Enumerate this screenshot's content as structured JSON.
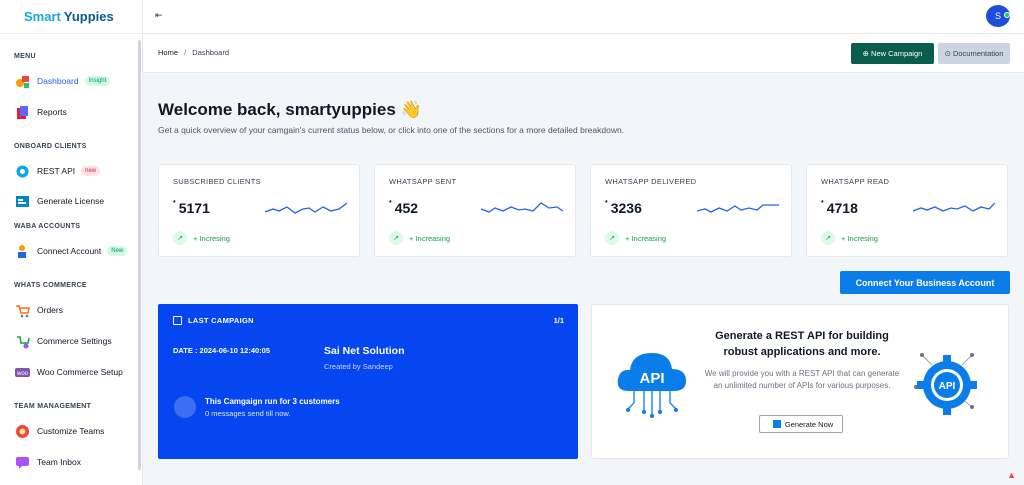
{
  "brand": {
    "word1": "Smart",
    "word2": "Yuppies"
  },
  "topbar": {
    "collapse_glyph": "⇤",
    "avatar_letter": "S"
  },
  "sidebar": {
    "sections": [
      {
        "label": "MENU"
      },
      {
        "label": "ONBOARD CLIENTS"
      },
      {
        "label": "WABA ACCOUNTS"
      },
      {
        "label": "WHATS COMMERCE"
      },
      {
        "label": "TEAM MANAGEMENT"
      }
    ],
    "items": [
      {
        "label": "Dashboard",
        "badge": "Insight",
        "icon": "dashboard-icon"
      },
      {
        "label": "Reports",
        "icon": "reports-icon"
      },
      {
        "label": "REST API",
        "badge": "new",
        "icon": "rest-api-icon"
      },
      {
        "label": "Generate License",
        "icon": "license-icon"
      },
      {
        "label": "Connect Account",
        "badge": "New",
        "icon": "connect-account-icon"
      },
      {
        "label": "Orders",
        "icon": "orders-icon"
      },
      {
        "label": "Commerce Settings",
        "icon": "commerce-settings-icon"
      },
      {
        "label": "Woo Commerce Setup",
        "icon": "woo-icon"
      },
      {
        "label": "Customize Teams",
        "icon": "teams-icon"
      },
      {
        "label": "Team Inbox",
        "icon": "inbox-icon"
      }
    ]
  },
  "breadcrumb": {
    "home": "Home",
    "sep": "/",
    "current": "Dashboard"
  },
  "actions": {
    "new_campaign": "⊕ New Campaign",
    "documentation": "⊙ Documentation",
    "connect": "Connect Your Business Account"
  },
  "welcome": {
    "title": "Welcome back, smartyuppies 👋",
    "subtitle": "Get a quick overview of your camgain's current status below, or click into one of the sections for a more detailed breakdown."
  },
  "stats": [
    {
      "title": "SUBSCRIBED CLIENTS",
      "value": "5171",
      "trend": "+ Incresing"
    },
    {
      "title": "WHATSAPP SENT",
      "value": "452",
      "trend": "+ Increasing"
    },
    {
      "title": "WHATSAPP DELIVERED",
      "value": "3236",
      "trend": "+ Increasing"
    },
    {
      "title": "WHATSAPP READ",
      "value": "4718",
      "trend": "+ Incresing"
    }
  ],
  "campaign": {
    "header": "LAST CAMPAIGN",
    "page": "1/1",
    "date": "DATE : 2024-06-10 12:40:05",
    "name": "Sai Net Solution",
    "created_by": "Created by Sandeep",
    "run": "This Camgaign run for 3 customers",
    "messages": "0 messages send till now."
  },
  "api_card": {
    "heading": "Generate a REST API for building robust applications and more.",
    "body": "We will provide you with a REST API that can generate an unlimited number of APIs for various purposes.",
    "button": "Generate Now",
    "art_text": "API"
  },
  "colors": {
    "accent": "#0646f0",
    "brand_green": "#0a5c4d",
    "primary_blue": "#0b7de8",
    "trend_green": "#16a34a"
  }
}
